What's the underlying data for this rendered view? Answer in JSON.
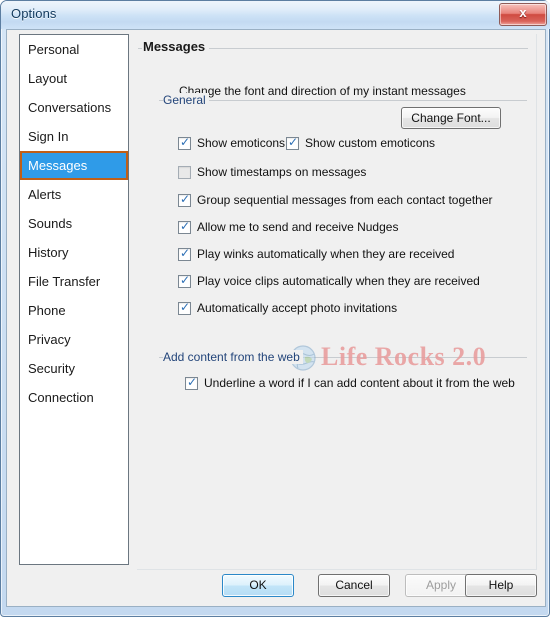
{
  "window": {
    "title": "Options",
    "close_label": "x",
    "close_icon": "close-icon"
  },
  "sidebar": {
    "items": [
      {
        "label": "Personal",
        "selected": false
      },
      {
        "label": "Layout",
        "selected": false
      },
      {
        "label": "Conversations",
        "selected": false
      },
      {
        "label": "Sign In",
        "selected": false
      },
      {
        "label": "Messages",
        "selected": true
      },
      {
        "label": "Alerts",
        "selected": false
      },
      {
        "label": "Sounds",
        "selected": false
      },
      {
        "label": "History",
        "selected": false
      },
      {
        "label": "File Transfer",
        "selected": false
      },
      {
        "label": "Phone",
        "selected": false
      },
      {
        "label": "Privacy",
        "selected": false
      },
      {
        "label": "Security",
        "selected": false
      },
      {
        "label": "Connection",
        "selected": false
      }
    ]
  },
  "main": {
    "page_title": "Messages",
    "groups": {
      "general": {
        "label": "General",
        "description": "Change the font and direction of my instant messages",
        "change_font_button": "Change Font...",
        "checkboxes": [
          {
            "label": "Show emoticons",
            "checked": true,
            "disabled": false
          },
          {
            "label": "Show custom emoticons",
            "checked": true,
            "disabled": false
          },
          {
            "label": "Show timestamps on messages",
            "checked": false,
            "disabled": false
          },
          {
            "label": "Group sequential messages from each contact together",
            "checked": true,
            "disabled": false
          },
          {
            "label": "Allow me to send and receive Nudges",
            "checked": true,
            "disabled": false
          },
          {
            "label": "Play winks automatically when they are received",
            "checked": true,
            "disabled": false
          },
          {
            "label": "Play voice clips automatically when they are received",
            "checked": true,
            "disabled": false
          },
          {
            "label": "Automatically accept photo invitations",
            "checked": true,
            "disabled": false
          }
        ],
        "emoticon_icons": [
          "smiley-emoticon",
          "star-emoticon",
          "rose-emoticon"
        ]
      },
      "web": {
        "label": "Add content from the web",
        "checkboxes": [
          {
            "label": "Underline a word if I can add content about it from the web",
            "checked": true,
            "disabled": false
          }
        ]
      }
    }
  },
  "watermark": {
    "text": "Life Rocks 2.0",
    "icon": "globe-icon",
    "color": "#e89a9a"
  },
  "footer": {
    "buttons": [
      {
        "label": "OK",
        "style": "default"
      },
      {
        "label": "Cancel",
        "style": "normal"
      },
      {
        "label": "Apply",
        "style": "disabled"
      },
      {
        "label": "Help",
        "style": "normal"
      }
    ]
  },
  "colors": {
    "selection_blue": "#2f9be8",
    "selection_border": "#c05f17",
    "group_label": "#23457a",
    "check_blue": "#2d6fb5",
    "close_red": "#cf4b40"
  }
}
